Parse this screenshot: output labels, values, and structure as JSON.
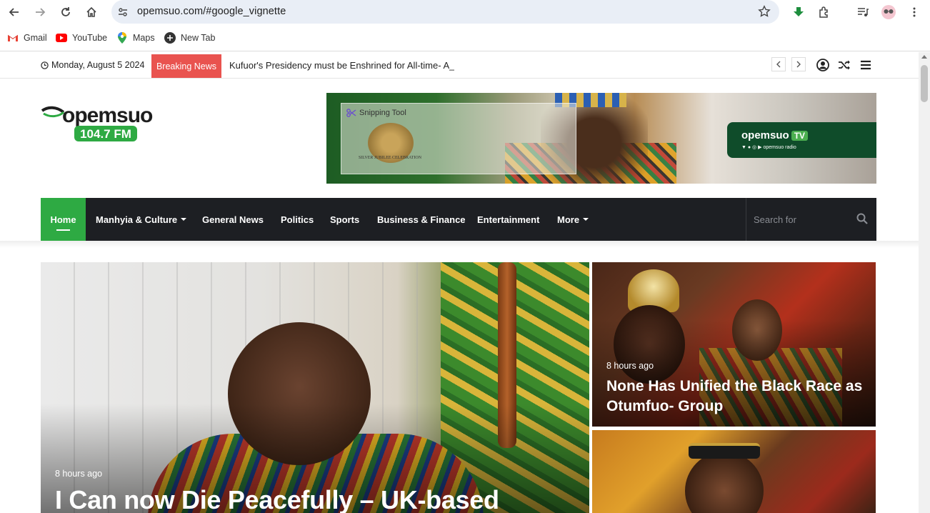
{
  "browser": {
    "url": "opemsuo.com/#google_vignette",
    "bookmarks": [
      {
        "label": "Gmail",
        "icon": "gmail-icon"
      },
      {
        "label": "YouTube",
        "icon": "youtube-icon"
      },
      {
        "label": "Maps",
        "icon": "maps-icon"
      },
      {
        "label": "New Tab",
        "icon": "new-tab-icon"
      }
    ]
  },
  "topbar": {
    "date": "Monday, August 5 2024",
    "breaking_label": "Breaking News",
    "ticker_text": "Kufuor's Presidency must be Enshrined for All-time- A_"
  },
  "logo": {
    "name": "opemsuo",
    "frequency": "104.7 FM"
  },
  "banner": {
    "snipping_label": "Snipping Tool",
    "jubilee_text": "SILVER JUBILEE CELEBRATION",
    "tv_name": "opemsuo",
    "tv_badge": "TV",
    "tv_handle": "opemsuo radio"
  },
  "nav": {
    "items": [
      {
        "label": "Home",
        "active": true
      },
      {
        "label": "Manhyia & Culture",
        "dropdown": true
      },
      {
        "label": "General News"
      },
      {
        "label": "Politics"
      },
      {
        "label": "Sports"
      },
      {
        "label": "Business & Finance"
      },
      {
        "label": "Entertainment"
      },
      {
        "label": "More",
        "dropdown": true
      }
    ],
    "search_placeholder": "Search for"
  },
  "featured": {
    "time": "8 hours ago",
    "title": "I Can now Die Peacefully – UK-based"
  },
  "side_articles": [
    {
      "time": "8 hours ago",
      "title": "None Has Unified the Black Race as Otumfuo- Group"
    },
    {
      "time": "",
      "title": ""
    }
  ],
  "colors": {
    "brand_green": "#2eaa43",
    "breaking_red": "#e9534f",
    "nav_dark": "#1d1f23"
  }
}
